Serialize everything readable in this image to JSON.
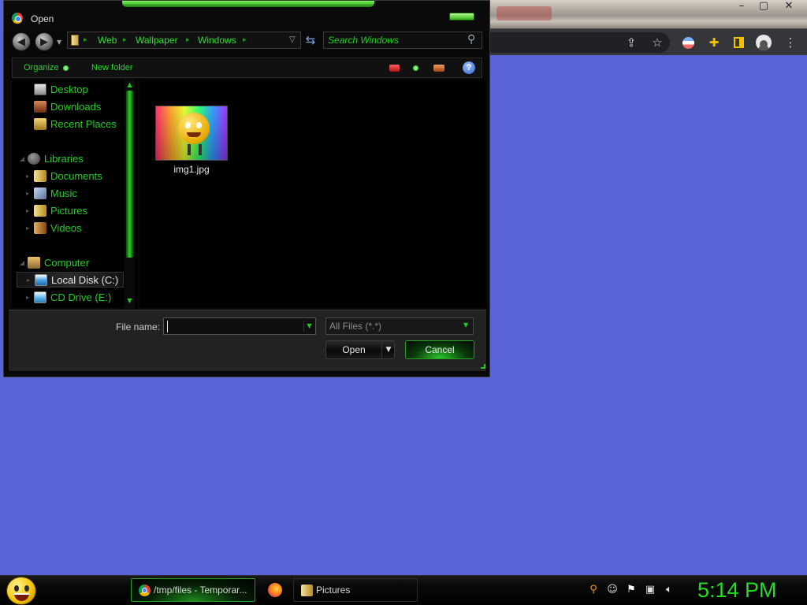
{
  "dialog": {
    "title": "Open",
    "breadcrumbs": [
      "Web",
      "Wallpaper",
      "Windows"
    ],
    "search_placeholder": "Search Windows",
    "commands": {
      "organize": "Organize",
      "new_folder": "New folder",
      "help": "?"
    },
    "nav": {
      "favorites": [
        "Desktop",
        "Downloads",
        "Recent Places"
      ],
      "libraries_label": "Libraries",
      "libraries": [
        "Documents",
        "Music",
        "Pictures",
        "Videos"
      ],
      "computer_label": "Computer",
      "drives": [
        "Local Disk (C:)",
        "CD Drive (E:)"
      ],
      "selected": "Local Disk (C:)"
    },
    "files": [
      {
        "name": "img1.jpg",
        "type": "image"
      }
    ],
    "file_name_label": "File name:",
    "file_name_value": "",
    "file_type_filter": "All Files (*.*)",
    "open_label": "Open",
    "cancel_label": "Cancel"
  },
  "browser": {
    "window_controls": [
      "–",
      "▢",
      "✕"
    ],
    "toolbar_icons": [
      "share-icon",
      "bookmark-star-icon",
      "profile-color-icon",
      "extensions-icon",
      "side-panel-icon",
      "account-icon",
      "menu-icon"
    ]
  },
  "taskbar": {
    "tasks": [
      {
        "label": "/tmp/files - Temporar...",
        "icon": "chrome-icon",
        "active": true
      },
      {
        "label": "",
        "icon": "firefox-icon",
        "active": false
      },
      {
        "label": "Pictures",
        "icon": "folder-icon",
        "active": false
      }
    ],
    "tray_icons": [
      "search-icon",
      "messenger-icon",
      "flag-icon",
      "network-icon",
      "volume-icon"
    ],
    "clock": "5:14 PM"
  },
  "colors": {
    "desktop": "#5a64d8",
    "accent_green": "#22cc22",
    "dialog_bg": "#080808",
    "browser_toolbar": "#35363a"
  }
}
